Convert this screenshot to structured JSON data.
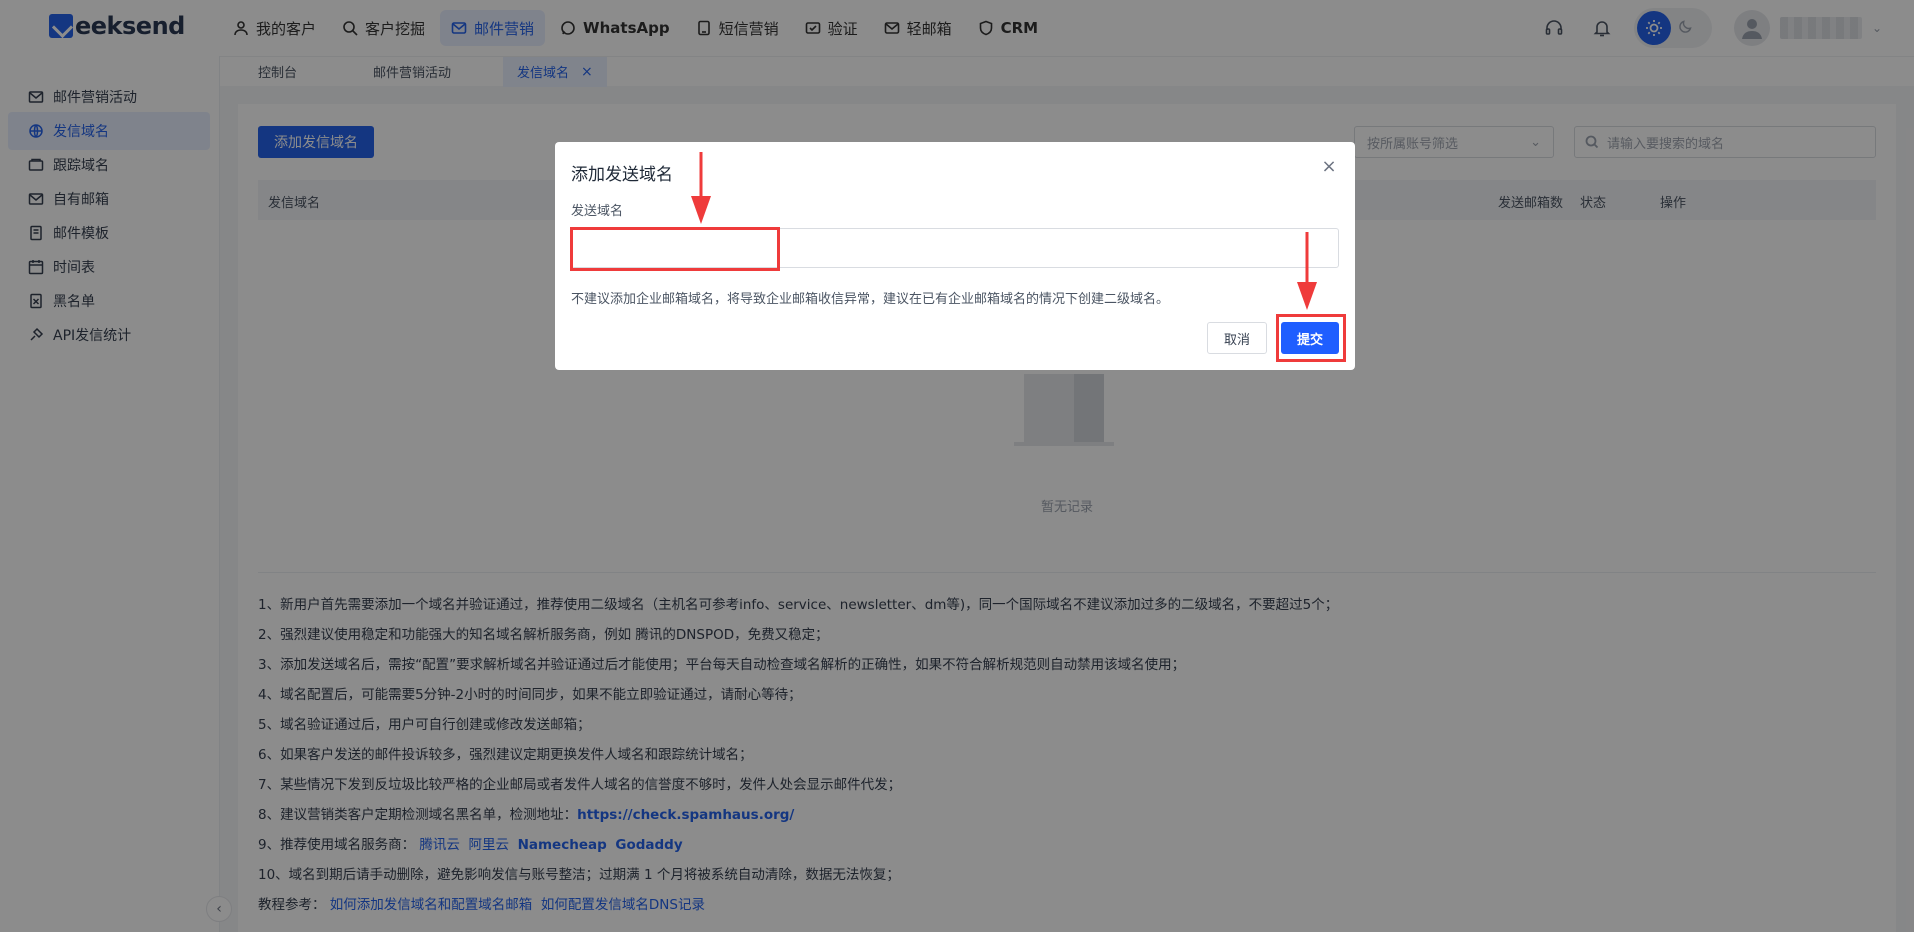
{
  "brand": {
    "name": "eeksend"
  },
  "nav": [
    {
      "label": "我的客户",
      "icon": "user-icon"
    },
    {
      "label": "客户挖掘",
      "icon": "search-icon"
    },
    {
      "label": "邮件营销",
      "icon": "mail-icon",
      "active": true
    },
    {
      "label": "WhatsApp",
      "icon": "whatsapp-icon"
    },
    {
      "label": "短信营销",
      "icon": "sms-icon"
    },
    {
      "label": "验证",
      "icon": "verify-icon"
    },
    {
      "label": "轻邮箱",
      "icon": "light-mail-icon"
    },
    {
      "label": "CRM",
      "icon": "crm-icon"
    }
  ],
  "tabs": [
    {
      "label": "控制台"
    },
    {
      "label": "邮件营销活动"
    },
    {
      "label": "发信域名",
      "active": true
    }
  ],
  "sidebar": [
    {
      "label": "邮件营销活动",
      "icon": "campaign-icon"
    },
    {
      "label": "发信域名",
      "icon": "domain-icon",
      "active": true
    },
    {
      "label": "跟踪域名",
      "icon": "tracking-icon"
    },
    {
      "label": "自有邮箱",
      "icon": "mailbox-icon"
    },
    {
      "label": "邮件模板",
      "icon": "template-icon"
    },
    {
      "label": "时间表",
      "icon": "schedule-icon"
    },
    {
      "label": "黑名单",
      "icon": "blacklist-icon"
    },
    {
      "label": "API发信统计",
      "icon": "api-icon"
    }
  ],
  "toolbar": {
    "add_label": "添加发信域名",
    "filter_placeholder": "按所属账号筛选",
    "search_placeholder": "请输入要搜索的域名"
  },
  "table": {
    "columns": [
      "发信域名",
      "发送邮箱数",
      "状态",
      "操作"
    ],
    "empty_text": "暂无记录"
  },
  "notes": [
    "1、新用户首先需要添加一个域名并验证通过，推荐使用二级域名（主机名可参考info、service、newsletter、dm等)，同一个国际域名不建议添加过多的二级域名，不要超过5个；",
    "2、强烈建议使用稳定和功能强大的知名域名解析服务商，例如 腾讯的DNSPOD，免费又稳定；",
    "3、添加发送域名后，需按“配置”要求解析域名并验证通过后才能使用；平台每天自动检查域名解析的正确性，如果不符合解析规范则自动禁用该域名使用；",
    "4、域名配置后，可能需要5分钟-2小时的时间同步，如果不能立即验证通过，请耐心等待；",
    "5、域名验证通过后，用户可自行创建或修改发送邮箱；",
    "6、如果客户发送的邮件投诉较多，强烈建议定期更换发件人域名和跟踪统计域名；",
    "7、某些情况下发到反垃圾比较严格的企业邮局或者发件人域名的信誉度不够时，发件人处会显示邮件代发；",
    "8、建议营销类客户定期检测域名黑名单，检测地址："
  ],
  "note8_link": "https://check.spamhaus.org/",
  "note9": {
    "prefix": "9、推荐使用域名服务商：",
    "links": [
      "腾讯云",
      "阿里云",
      "Namecheap",
      "Godaddy"
    ]
  },
  "note10": "10、域名到期后请手动删除，避免影响发信与账号整洁；过期满 1 个月将被系统自动清除，数据无法恢复；",
  "tutorial": {
    "prefix": "教程参考：",
    "links": [
      "如何添加发信域名和配置域名邮箱",
      "如何配置发信域名DNS记录"
    ]
  },
  "modal": {
    "title": "添加发送域名",
    "field_label": "发送域名",
    "field_value": "",
    "hint": "不建议添加企业邮箱域名，将导致企业邮箱收信异常，建议在已有企业邮箱域名的情况下创建二级域名。",
    "cancel_label": "取消",
    "submit_label": "提交"
  },
  "colors": {
    "accent": "#2563eb",
    "annotation": "#ef3b3b"
  }
}
